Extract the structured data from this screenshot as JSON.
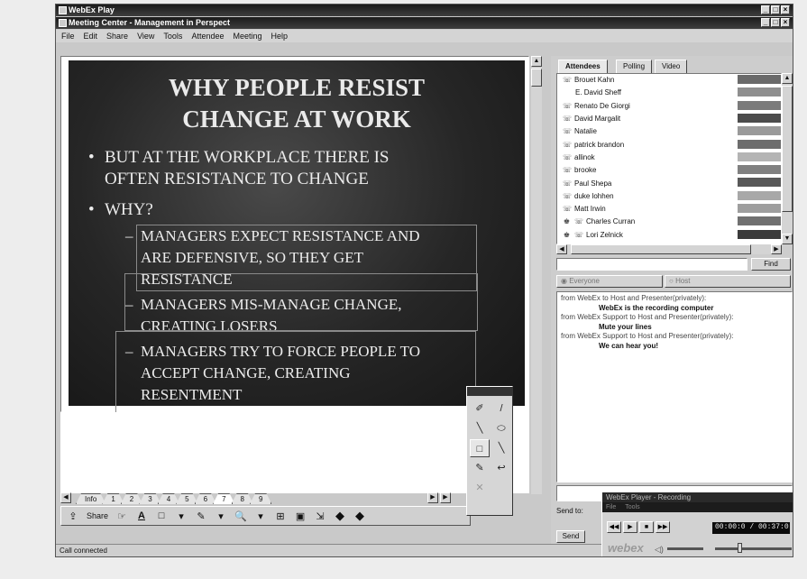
{
  "outer_window": {
    "title": "WebEx Play",
    "buttons": [
      "_",
      "□",
      "×"
    ]
  },
  "inner_window": {
    "title": "Meeting Center - Management in Perspect",
    "buttons": [
      "_",
      "□",
      "×"
    ]
  },
  "menu": [
    "File",
    "Edit",
    "Share",
    "View",
    "Tools",
    "Attendee",
    "Meeting",
    "Help"
  ],
  "slide": {
    "title_line1": "WHY PEOPLE RESIST",
    "title_line2": "CHANGE AT WORK",
    "bullet1_line1": "BUT AT THE WORKPLACE THERE IS",
    "bullet1_line2": "OFTEN RESISTANCE TO CHANGE",
    "bullet2": "WHY?",
    "sub1_line1": "MANAGERS EXPECT RESISTANCE AND",
    "sub1_line2": "ARE DEFENSIVE, SO THEY GET",
    "sub1_line3": "RESISTANCE",
    "sub2_line1": "MANAGERS MIS-MANAGE CHANGE,",
    "sub2_line2": "CREATING LOSERS",
    "sub3_line1": "MANAGERS TRY TO FORCE PEOPLE TO",
    "sub3_line2": "ACCEPT CHANGE, CREATING",
    "sub3_line3": "RESENTMENT",
    "bullet_glyph": "•",
    "dash_glyph": "–"
  },
  "page_tabs": [
    "Info",
    "1",
    "2",
    "3",
    "4",
    "5",
    "6",
    "7",
    "8",
    "9"
  ],
  "active_page_tab": "7",
  "toolbar": {
    "share_label": "Share",
    "share_icon": "share-icon",
    "pointer_icon": "pointer-icon",
    "text_tool": "A",
    "rect_tool": "□",
    "dropdown": "▾",
    "highlighter_tool": "✎",
    "zoom_icon": "🔍",
    "fit_icons": [
      "⊞",
      "▣",
      "⇲"
    ],
    "prev": "◆",
    "next": "◆"
  },
  "annotation_palette": {
    "tools": [
      "✐",
      "/",
      "╲",
      "⬭",
      "□",
      "╲",
      "✎",
      "↩",
      "✕",
      ""
    ]
  },
  "right_panel": {
    "tabs": [
      "Attendees",
      "Polling",
      "Video"
    ],
    "attendees": [
      "Brouet Kahn",
      "E. David Sheff",
      "Renato De Giorgi",
      "David Margalit",
      "Natalie",
      "patrick brandon",
      "allinok",
      "brooke",
      "Paul Shepa",
      "duke lohhen",
      "Matt Irwin",
      "Charles Curran",
      "Lori Zelnick"
    ],
    "swatch_colors": [
      "#6a6a6a",
      "#8f8f8f",
      "#7b7b7b",
      "#4c4c4c",
      "#9a9a9a",
      "#6d6d6d",
      "#b4b4b4",
      "#808080",
      "#585858",
      "#a8a8a8",
      "#9e9e9e",
      "#707070",
      "#3b3b3b"
    ],
    "find_button": "Find",
    "chat_tabs": [
      "Everyone",
      "Host"
    ],
    "chat": [
      {
        "from": "from WebEx to Host and Presenter(privately):",
        "msg": "WebEx is the recording computer"
      },
      {
        "from": "from WebEx Support to Host and Presenter(privately):",
        "msg": "Mute your lines"
      },
      {
        "from": "from WebEx Support to Host and Presenter(privately):",
        "msg": "We can hear you!"
      }
    ],
    "send_to_label": "Send to:",
    "send_btn": "Send"
  },
  "status": "Call connected",
  "recorder": {
    "title": "WebEx Player - Recording",
    "menu": [
      "File",
      "Tools"
    ],
    "time": "00:00:0 / 00:37:0",
    "brand": "webex",
    "controls": [
      "◀◀",
      "▶",
      "■",
      "▶▶"
    ]
  }
}
